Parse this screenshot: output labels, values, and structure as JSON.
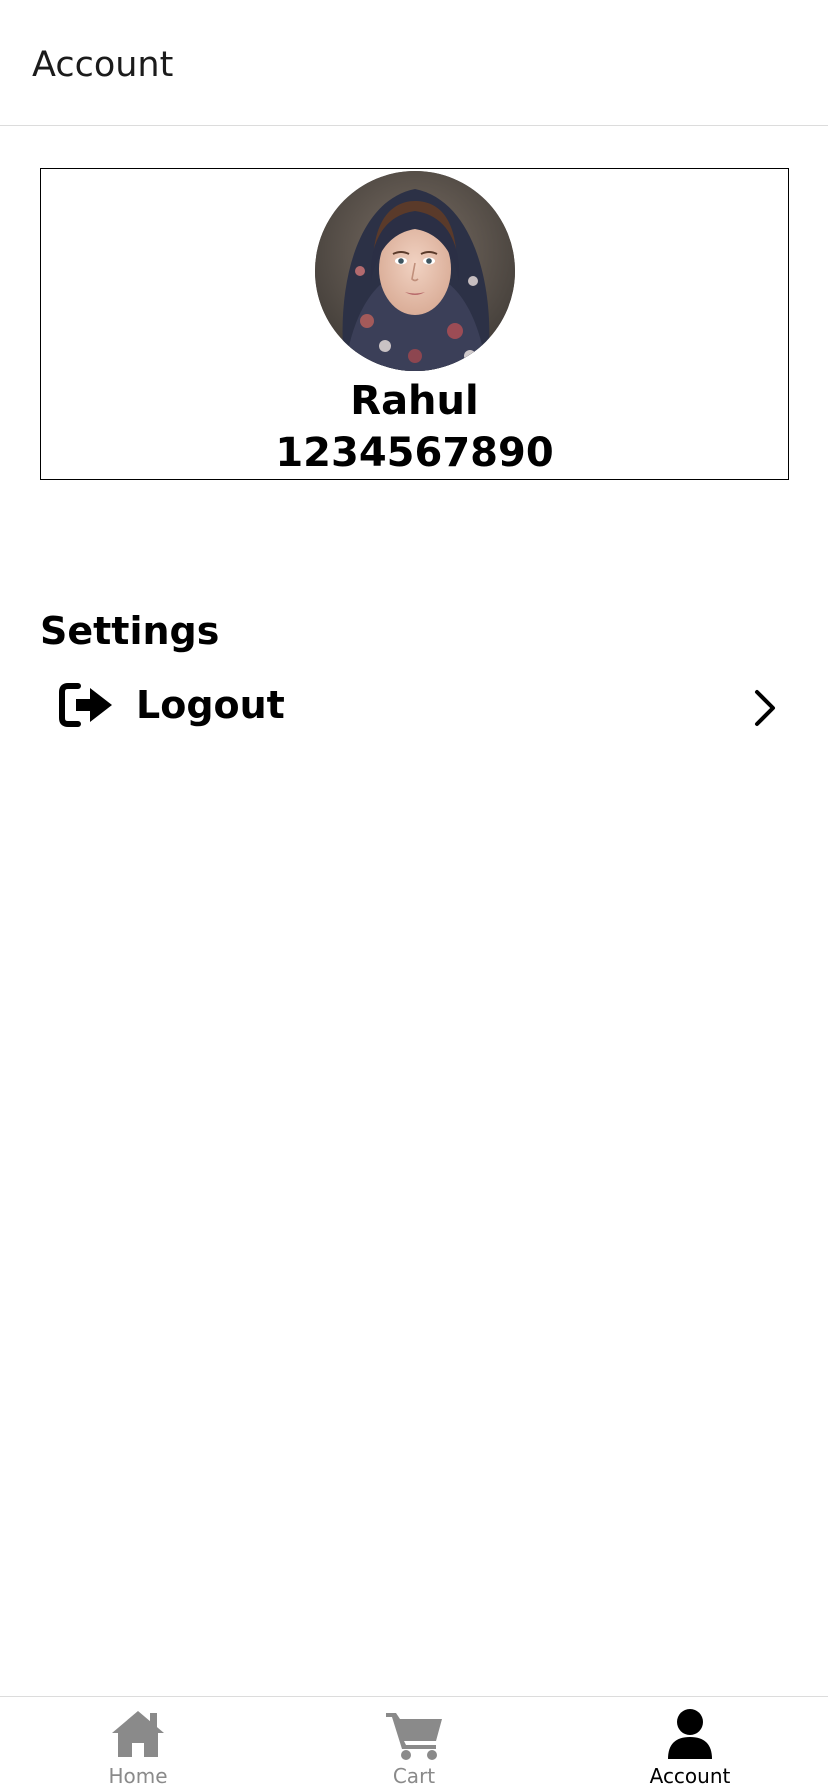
{
  "header": {
    "title": "Account"
  },
  "profile": {
    "name": "Rahul",
    "phone": "1234567890",
    "avatar_icon": "profile-photo"
  },
  "settings": {
    "title": "Settings",
    "items": [
      {
        "label": "Logout",
        "icon": "logout-icon",
        "trailing_icon": "chevron-right-icon"
      }
    ]
  },
  "bottom_nav": {
    "active": "Account",
    "items": [
      {
        "label": "Home",
        "icon": "home-icon",
        "color": "#8a8a8a"
      },
      {
        "label": "Cart",
        "icon": "cart-icon",
        "color": "#8a8a8a"
      },
      {
        "label": "Account",
        "icon": "user-icon",
        "color": "#000000"
      }
    ]
  },
  "colors": {
    "background": "#ffffff",
    "text": "#000000",
    "inactive_nav": "#8a8a8a",
    "divider": "#dcdcdc"
  }
}
